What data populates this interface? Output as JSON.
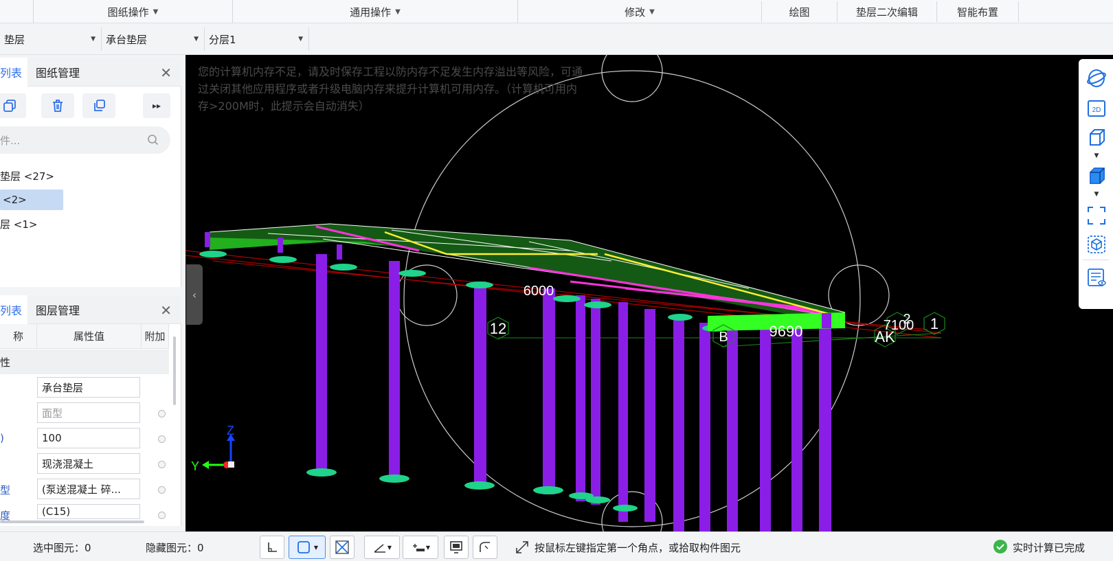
{
  "ribbon": {
    "groups": [
      "图纸操作",
      "通用操作",
      "修改"
    ],
    "buttons": [
      "绘图",
      "垫层二次编辑",
      "智能布置"
    ]
  },
  "selectors": {
    "type": "垫层",
    "name": "承台垫层",
    "layer": "分层1"
  },
  "panel1": {
    "tab_partial": "列表",
    "tab_drawing": "图纸管理",
    "search_placeholder": "件...",
    "tree": [
      "垫层 <27>",
      "<2>",
      "层 <1>"
    ]
  },
  "panel2": {
    "tab_partial": "列表",
    "tab_layers": "图层管理",
    "headers": [
      "称",
      "属性值",
      "附加"
    ],
    "section": "性",
    "rows": [
      {
        "label": "",
        "value": "承台垫层",
        "dim": false,
        "dot": false
      },
      {
        "label": "",
        "value": "面型",
        "dim": true,
        "dot": true
      },
      {
        "label": ")",
        "value": "100",
        "dim": false,
        "dot": true
      },
      {
        "label": "",
        "value": "现浇混凝土",
        "dim": false,
        "dot": true
      },
      {
        "label": "型",
        "value": "(泵送混凝土 碎...",
        "dim": false,
        "dot": true
      },
      {
        "label": "度",
        "value": "(C15)",
        "dim": false,
        "dot": true
      }
    ]
  },
  "viewport": {
    "warning": "您的计算机内存不足，请及时保存工程以防内存不足发生内存溢出等风险，可通过关闭其他应用程序或者升级电脑内存来提升计算机可用内存。（计算机可用内存>200M时，此提示会自动消失）",
    "axis_labels": {
      "label_12": "12",
      "label_b": "B",
      "label_9690": "9690",
      "label_2": "2",
      "label_7100": "7100",
      "label_1": "1",
      "label_ak": "AK",
      "label_6000": "6000"
    },
    "axis_z": "Z",
    "axis_y": "Y"
  },
  "viewtools": [
    "orbit-icon",
    "2d-view-icon",
    "3d-box-icon",
    "solid-box-icon",
    "fullscreen-icon",
    "display-cube-icon",
    "layer-visibility-icon"
  ],
  "status": {
    "selected": "选中图元：0",
    "hidden": "隐藏图元：0",
    "prompt": "按鼠标左键指定第一个角点，或拾取构件图元",
    "calc": "实时计算已完成"
  },
  "colors": {
    "accent": "#2f6ee8",
    "ok": "#3cb54a",
    "column": "#8a1ee6",
    "slab": "#22c81e"
  }
}
